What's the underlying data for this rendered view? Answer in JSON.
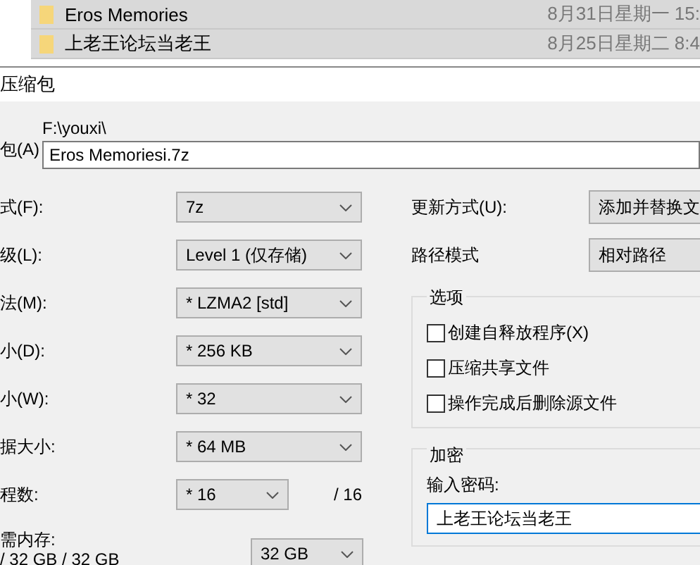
{
  "file_list": [
    {
      "name": "Eros Memories",
      "date": "8月31日星期一 15:"
    },
    {
      "name": "上老王论坛当老王",
      "date": "8月25日星期二 8:4"
    }
  ],
  "dialog": {
    "title": "压缩包"
  },
  "archive": {
    "label": "包(A)",
    "path": "F:\\youxi\\",
    "value": "Eros Memoriesi.7z"
  },
  "left_fields": [
    {
      "label": "式(F):",
      "value": "7z"
    },
    {
      "label": "级(L):",
      "value": "Level 1 (仅存储)"
    },
    {
      "label": "法(M):",
      "value": "* LZMA2 [std]"
    },
    {
      "label": "小(D):",
      "value": "* 256 KB"
    },
    {
      "label": "小(W):",
      "value": "* 32"
    },
    {
      "label": "据大小:",
      "value": "* 64 MB"
    },
    {
      "label": "程数:",
      "value": "* 16",
      "suffix": "/ 16"
    }
  ],
  "memory": {
    "label": "需内存:",
    "detail": "/ 32 GB / 32 GB",
    "value": "32 GB"
  },
  "right_fields": [
    {
      "label": "更新方式(U):",
      "value": "添加并替换文"
    },
    {
      "label": "路径模式",
      "value": "相对路径"
    }
  ],
  "options": {
    "title": "选项",
    "items": [
      {
        "label": "创建自释放程序(X)",
        "checked": false
      },
      {
        "label": "压缩共享文件",
        "checked": false
      },
      {
        "label": "操作完成后删除源文件",
        "checked": false
      }
    ]
  },
  "encryption": {
    "title": "加密",
    "label": "输入密码:",
    "value": "上老王论坛当老王"
  }
}
